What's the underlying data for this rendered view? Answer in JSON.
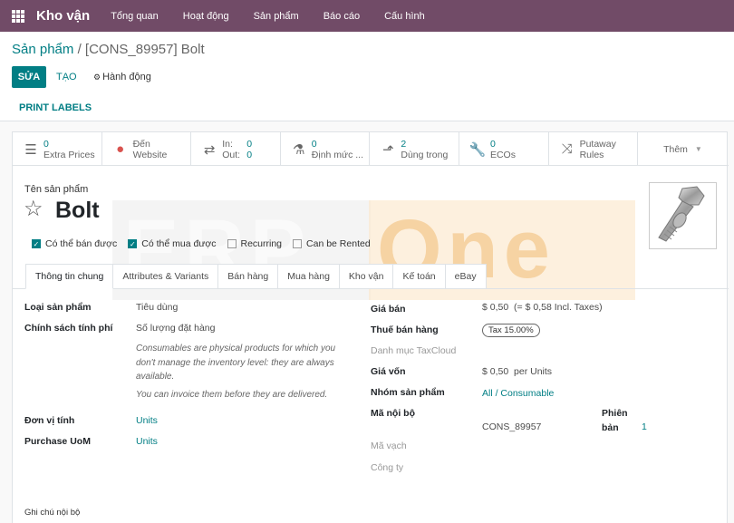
{
  "navbar": {
    "app_name": "Kho vận",
    "menu": [
      "Tổng quan",
      "Hoạt động",
      "Sản phẩm",
      "Báo cáo",
      "Cấu hình"
    ]
  },
  "breadcrumb": {
    "parent": "Sản phẩm",
    "separator": "/",
    "current": "[CONS_89957] Bolt"
  },
  "buttons": {
    "edit": "SỬA",
    "create": "TẠO",
    "action": "Hành động",
    "print_labels": "PRINT LABELS"
  },
  "smart_buttons": [
    {
      "icon": "list-icon",
      "num": "0",
      "label": "Extra Prices"
    },
    {
      "icon": "globe-icon",
      "num": "Đến",
      "label": "Website"
    },
    {
      "icon": "exchange-icon",
      "in_label": "In:",
      "in_value": "0",
      "out_label": "Out:",
      "out_value": "0"
    },
    {
      "icon": "flask-icon",
      "num": "0",
      "label": "Định mức ..."
    },
    {
      "icon": "level-up-icon",
      "num": "2",
      "label": "Dùng trong"
    },
    {
      "icon": "wrench-icon",
      "num": "0",
      "label": "ECOs"
    },
    {
      "icon": "random-icon",
      "num": "Putaway",
      "label": "Rules"
    },
    {
      "label": "Thêm"
    }
  ],
  "product": {
    "name_label": "Tên sản phẩm",
    "name": "Bolt",
    "watermark_left": "ERP",
    "watermark_right": "One"
  },
  "checkboxes": [
    {
      "label": "Có thể bán được",
      "checked": true
    },
    {
      "label": "Có thể mua được",
      "checked": true
    },
    {
      "label": "Recurring",
      "checked": false
    },
    {
      "label": "Can be Rented",
      "checked": false
    }
  ],
  "tabs": [
    "Thông tin chung",
    "Attributes & Variants",
    "Bán hàng",
    "Mua hàng",
    "Kho vận",
    "Kế toán",
    "eBay"
  ],
  "left_fields": {
    "product_type_label": "Loại sản phẩm",
    "product_type_value": "Tiêu dùng",
    "invoice_policy_label": "Chính sách tính phí",
    "invoice_policy_value": "Số lượng đặt hàng",
    "help_1": "Consumables are physical products for which you don't manage the inventory level: they are always available.",
    "help_2": "You can invoice them before they are delivered.",
    "uom_label": "Đơn vị tính",
    "uom_value": "Units",
    "purchase_uom_label": "Purchase UoM",
    "purchase_uom_value": "Units"
  },
  "right_fields": {
    "sale_price_label": "Giá bán",
    "sale_price_value": "$ 0,50",
    "sale_price_incl": "(= $ 0,58 Incl. Taxes)",
    "taxes_label": "Thuế bán hàng",
    "taxes_value": "Tax 15.00%",
    "taxcloud_label": "Danh mục TaxCloud",
    "cost_label": "Giá vốn",
    "cost_value": "$ 0,50",
    "cost_unit": "per Units",
    "category_label": "Nhóm sản phẩm",
    "category_value": "All / Consumable",
    "ref_label": "Mã nội bộ",
    "ref_value": "CONS_89957",
    "version_label_1": "Phiên",
    "version_label_2": "bản",
    "version_value": "1",
    "barcode_label": "Mã vạch",
    "company_label": "Công ty"
  },
  "internal_notes_label": "Ghi chú nội bộ"
}
